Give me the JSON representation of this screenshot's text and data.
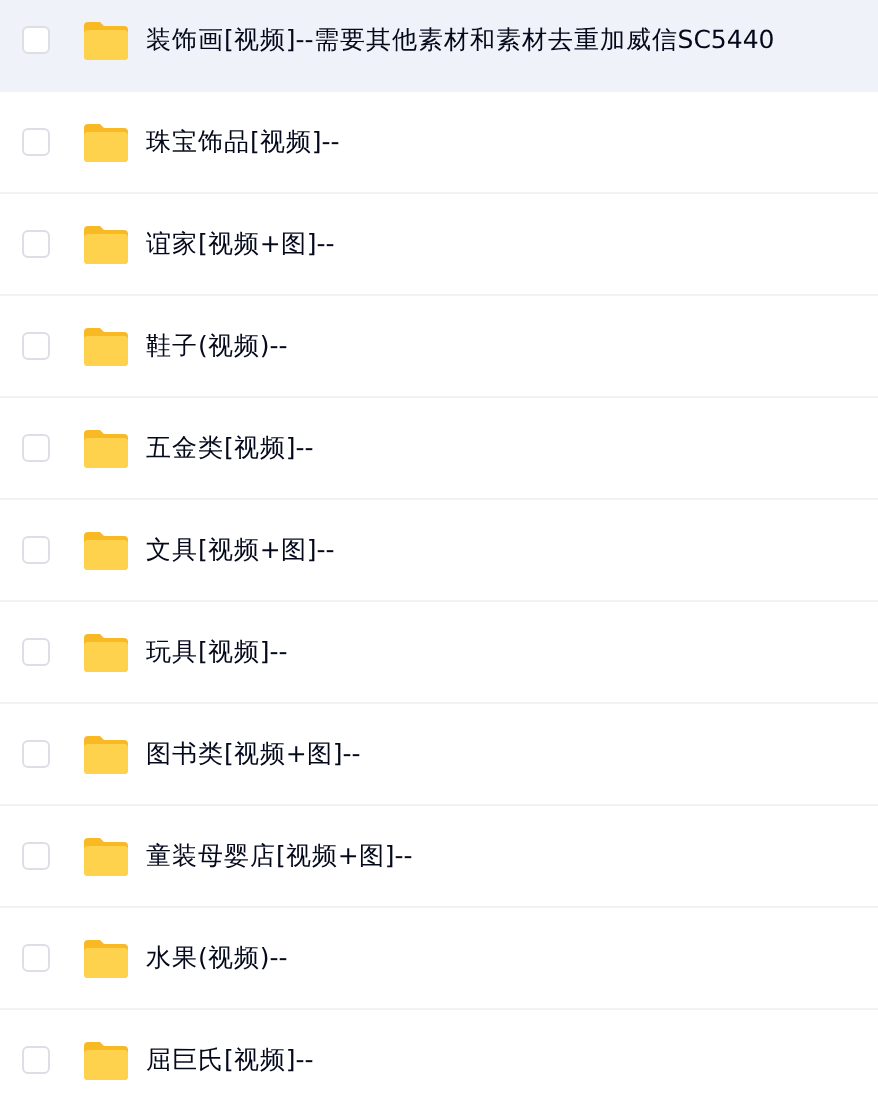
{
  "files": [
    {
      "name": "装饰画[视频]--需要其他素材和素材去重加威信SC5440",
      "checked": false,
      "hovered": true
    },
    {
      "name": "珠宝饰品[视频]--",
      "checked": false,
      "hovered": false
    },
    {
      "name": "谊家[视频+图]--",
      "checked": false,
      "hovered": false
    },
    {
      "name": "鞋子(视频)--",
      "checked": false,
      "hovered": false
    },
    {
      "name": "五金类[视频]--",
      "checked": false,
      "hovered": false
    },
    {
      "name": "文具[视频+图]--",
      "checked": false,
      "hovered": false
    },
    {
      "name": "玩具[视频]--",
      "checked": false,
      "hovered": false
    },
    {
      "name": "图书类[视频+图]--",
      "checked": false,
      "hovered": false
    },
    {
      "name": "童装母婴店[视频+图]--",
      "checked": false,
      "hovered": false
    },
    {
      "name": "水果(视频)--",
      "checked": false,
      "hovered": false
    },
    {
      "name": "屈巨氏[视频]--",
      "checked": false,
      "hovered": false
    }
  ]
}
